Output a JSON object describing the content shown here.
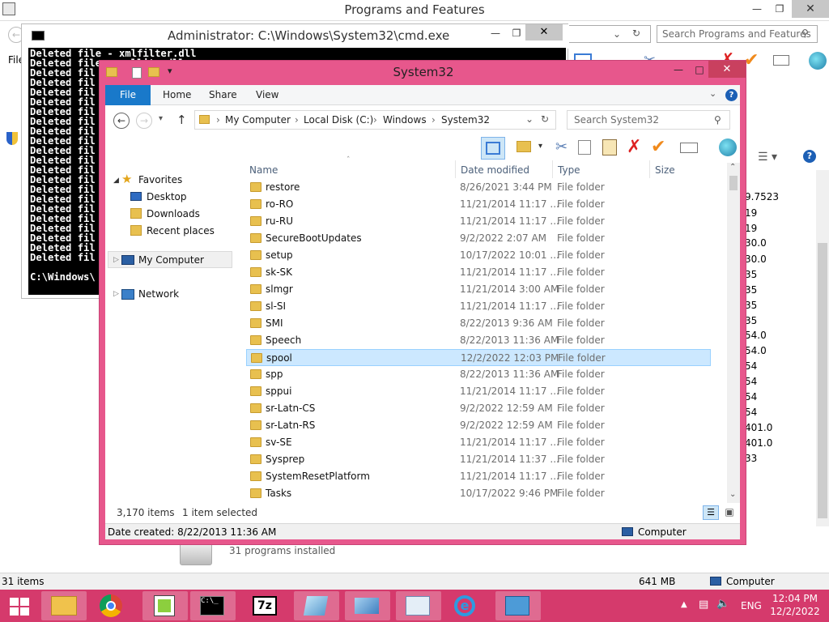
{
  "pf": {
    "title": "Programs and Features",
    "search_placeholder": "Search Programs and Features",
    "menu_file": "File",
    "installed": "31 programs installed",
    "status_items": "31 items",
    "status_size": "641 MB",
    "status_computer": "Computer",
    "values": [
      "9.7523",
      "19",
      "19",
      "30.0",
      "30.0",
      "35",
      "35",
      "35",
      "35",
      "54.0",
      "54.0",
      "54",
      "54",
      "54",
      "54",
      "401.0",
      "401.0",
      "33"
    ]
  },
  "cmd": {
    "title": "Administrator:  C:\\Windows\\System32\\cmd.exe",
    "lines": [
      "Deleted file - xmlfilter.dll",
      "Deleted file - xmllite.dll",
      "Deleted fil",
      "Deleted fil",
      "Deleted fil",
      "Deleted fil",
      "Deleted fil",
      "Deleted fil",
      "Deleted fil",
      "Deleted fil",
      "Deleted fil",
      "Deleted fil",
      "Deleted fil",
      "Deleted fil",
      "Deleted fil",
      "Deleted fil",
      "Deleted fil",
      "Deleted fil",
      "Deleted fil",
      "Deleted fil",
      "Deleted fil",
      "Deleted fil",
      "",
      "C:\\Windows\\"
    ]
  },
  "explorer": {
    "title": "System32",
    "tabs": {
      "file": "File",
      "home": "Home",
      "share": "Share",
      "view": "View"
    },
    "breadcrumb": [
      "My Computer",
      "Local Disk (C:)",
      "Windows",
      "System32"
    ],
    "search_placeholder": "Search System32",
    "nav": {
      "favorites": "Favorites",
      "desktop": "Desktop",
      "downloads": "Downloads",
      "recent": "Recent places",
      "my_computer": "My Computer",
      "network": "Network"
    },
    "columns": {
      "name": "Name",
      "date": "Date modified",
      "type": "Type",
      "size": "Size"
    },
    "rows": [
      {
        "name": "restore",
        "date": "8/26/2021 3:44 PM",
        "type": "File folder"
      },
      {
        "name": "ro-RO",
        "date": "11/21/2014 11:17 ...",
        "type": "File folder"
      },
      {
        "name": "ru-RU",
        "date": "11/21/2014 11:17 ...",
        "type": "File folder"
      },
      {
        "name": "SecureBootUpdates",
        "date": "9/2/2022 2:07 AM",
        "type": "File folder"
      },
      {
        "name": "setup",
        "date": "10/17/2022 10:01 ...",
        "type": "File folder"
      },
      {
        "name": "sk-SK",
        "date": "11/21/2014 11:17 ...",
        "type": "File folder"
      },
      {
        "name": "slmgr",
        "date": "11/21/2014 3:00 AM",
        "type": "File folder"
      },
      {
        "name": "sl-SI",
        "date": "11/21/2014 11:17 ...",
        "type": "File folder"
      },
      {
        "name": "SMI",
        "date": "8/22/2013 9:36 AM",
        "type": "File folder"
      },
      {
        "name": "Speech",
        "date": "8/22/2013 11:36 AM",
        "type": "File folder"
      },
      {
        "name": "spool",
        "date": "12/2/2022 12:03 PM",
        "type": "File folder"
      },
      {
        "name": "spp",
        "date": "8/22/2013 11:36 AM",
        "type": "File folder"
      },
      {
        "name": "sppui",
        "date": "11/21/2014 11:17 ...",
        "type": "File folder"
      },
      {
        "name": "sr-Latn-CS",
        "date": "9/2/2022 12:59 AM",
        "type": "File folder"
      },
      {
        "name": "sr-Latn-RS",
        "date": "9/2/2022 12:59 AM",
        "type": "File folder"
      },
      {
        "name": "sv-SE",
        "date": "11/21/2014 11:17 ...",
        "type": "File folder"
      },
      {
        "name": "Sysprep",
        "date": "11/21/2014 11:37 ...",
        "type": "File folder"
      },
      {
        "name": "SystemResetPlatform",
        "date": "11/21/2014 11:17 ...",
        "type": "File folder"
      },
      {
        "name": "Tasks",
        "date": "10/17/2022 9:46 PM",
        "type": "File folder"
      }
    ],
    "selected_row": "spool",
    "item_count": "3,170 items",
    "selected_count": "1 item selected",
    "date_created": "Date created: 8/22/2013 11:36 AM",
    "status_computer": "Computer"
  },
  "taskbar": {
    "lang": "ENG",
    "time": "12:04 PM",
    "date": "12/2/2022",
    "accent": "#d53a6c"
  }
}
